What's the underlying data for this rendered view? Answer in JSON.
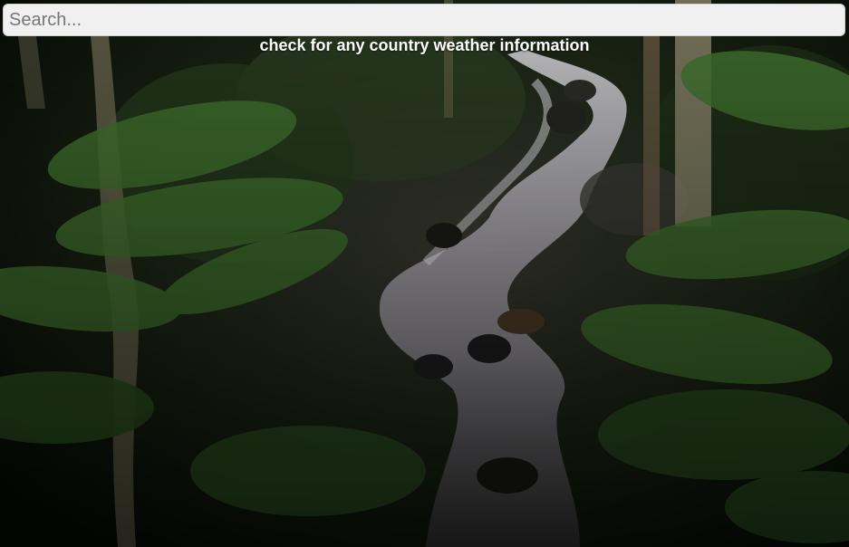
{
  "search": {
    "placeholder": "Search...",
    "value": ""
  },
  "tagline": "check for any country weather information",
  "background": {
    "subject": "forest stream waterfall photo",
    "colors": {
      "dark": "#0c130a",
      "foliage": "#2f5a25",
      "water": "#c9c6cc"
    }
  }
}
